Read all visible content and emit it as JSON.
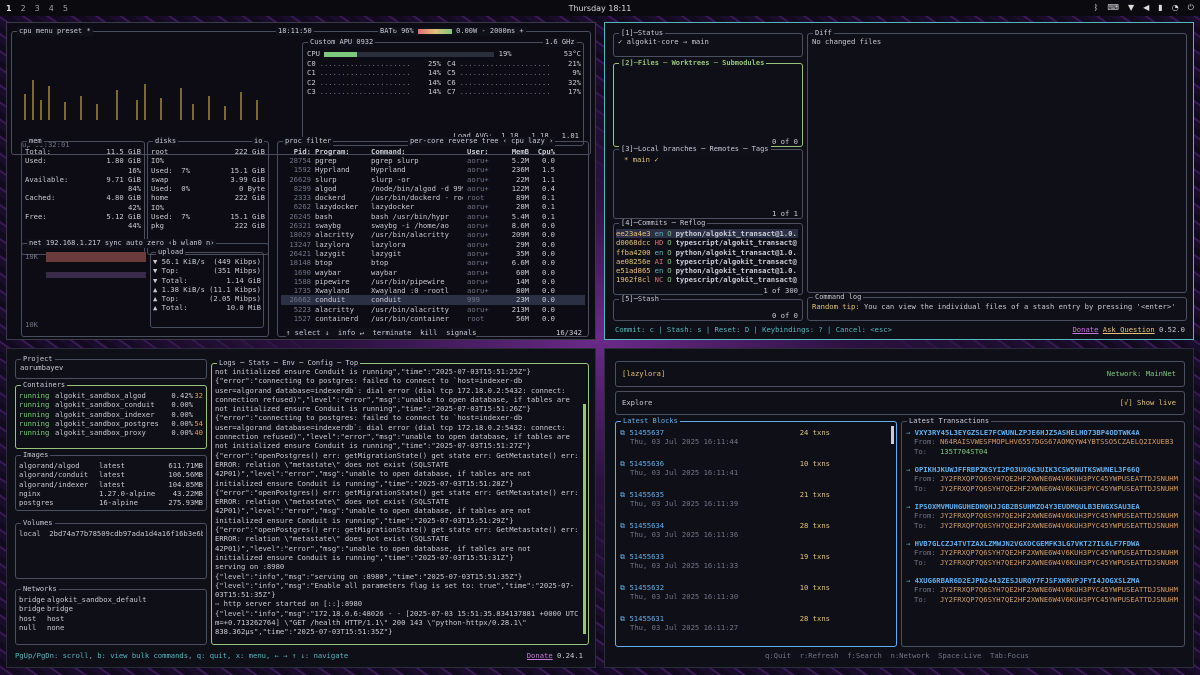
{
  "topbar": {
    "workspaces": [
      "1",
      "2",
      "3",
      "4",
      "5"
    ],
    "active": "1",
    "clock": "Thursday 18:11"
  },
  "btop": {
    "cpu_title": "cpu",
    "menu": "menu",
    "preset": "preset *",
    "time": "18:11:50",
    "bat": "BAT↻ 96%",
    "power": "0.00W",
    "interval": "- 2000ms +",
    "uptime": "up 00:32:01",
    "cpu_model": "Custom APU 0932",
    "freq": "1.6 GHz",
    "cpu_total": {
      "label": "CPU",
      "pct": "19%",
      "temp": "53°C",
      "fill": 0.19
    },
    "cores": [
      {
        "l": "C0",
        "p": "25%",
        "r": "C4",
        "rp": "21%"
      },
      {
        "l": "C1",
        "p": "14%",
        "r": "C5",
        "rp": "9%"
      },
      {
        "l": "C2",
        "p": "14%",
        "r": "C6",
        "rp": "32%"
      },
      {
        "l": "C3",
        "p": "14%",
        "r": "C7",
        "rp": "17%"
      }
    ],
    "load": "Load AVG:  1.18   1.18   1.01",
    "mem": {
      "title": "mem",
      "rows": [
        [
          "Total:",
          "11.5 GiB"
        ],
        [
          "Used:",
          "1.80 GiB"
        ],
        [
          "",
          "16%"
        ],
        [
          "Available:",
          "9.71 GiB"
        ],
        [
          "",
          "84%"
        ],
        [
          "Cached:",
          "4.80 GiB"
        ],
        [
          "",
          "42%"
        ],
        [
          "Free:",
          "5.12 GiB"
        ],
        [
          "",
          "44%"
        ]
      ]
    },
    "disks": {
      "title": "disks",
      "io": "io",
      "rows": [
        [
          "root",
          "222 GiB"
        ],
        [
          "IO%",
          ""
        ],
        [
          "Used:  7%",
          "15.1 GiB"
        ],
        [
          "swap",
          "3.99 GiB"
        ],
        [
          "Used:  0%",
          "0 Byte"
        ],
        [
          "home",
          "222 GiB"
        ],
        [
          "IO%",
          ""
        ],
        [
          "Used:  7%",
          "15.1 GiB"
        ],
        [
          "pkg",
          "222 GiB"
        ]
      ]
    },
    "net": {
      "title": "net",
      "ip": "192.168.1.217",
      "sync": "sync",
      "auto": "auto",
      "zero": "zero",
      "iface": "‹b wlan0 n›",
      "scale_top": "10K",
      "scale_bot": "10K",
      "upload": "upload",
      "rows": [
        [
          "▼ 56.1 KiB/s",
          "(449 Kibps)"
        ],
        [
          "▼ Top:",
          "(351 Mibps)"
        ],
        [
          "▼ Total:",
          "1.14 GiB"
        ],
        [
          "▲ 1.38 KiB/s",
          "(11.1 Kibps)"
        ],
        [
          "▲ Top:",
          "(2.05 Mibps)"
        ],
        [
          "▲ Total:",
          "10.0 MiB"
        ]
      ]
    },
    "proc": {
      "title": "proc",
      "filter": "filter",
      "opts": "per-core  reverse  tree  ‹ cpu lazy ›",
      "headers": [
        "Pid:",
        "Program:",
        "Command:",
        "User:",
        "MemB",
        "Cpu%"
      ],
      "rows": [
        [
          "28754",
          "pgrep",
          "pgrep slurp",
          "aoru+",
          "5.2M",
          "0.0"
        ],
        [
          "1592",
          "Hyprland",
          "Hyprland",
          "aoru+",
          "236M",
          "1.5"
        ],
        [
          "26629",
          "slurp",
          "slurp -or",
          "aoru+",
          "22M",
          "1.1"
        ],
        [
          "8299",
          "algod",
          "/node/bin/algod -d 999",
          "aoru+",
          "122M",
          "0.4"
        ],
        [
          "2333",
          "dockerd",
          "/usr/bin/dockerd - root",
          "root",
          "89M",
          "0.1"
        ],
        [
          "6262",
          "lazydocker",
          "lazydocker",
          "aoru+",
          "28M",
          "0.1"
        ],
        [
          "26245",
          "bash",
          "bash /usr/bin/hypr",
          "aoru+",
          "5.4M",
          "0.1"
        ],
        [
          "26321",
          "swaybg",
          "swaybg -i /home/ao",
          "aoru+",
          "8.6M",
          "0.0"
        ],
        [
          "18029",
          "alacritty",
          "/usr/bin/alacritty",
          "aoru+",
          "209M",
          "0.0"
        ],
        [
          "13247",
          "lazylora",
          "lazylora",
          "aoru+",
          "29M",
          "0.0"
        ],
        [
          "26421",
          "lazygit",
          "lazygit",
          "aoru+",
          "35M",
          "0.0"
        ],
        [
          "18148",
          "btop",
          "btop",
          "aoru+",
          "6.6M",
          "0.0"
        ],
        [
          "1690",
          "waybar",
          "waybar",
          "aoru+",
          "60M",
          "0.0"
        ],
        [
          "1588",
          "pipewire",
          "/usr/bin/pipewire",
          "aoru+",
          "14M",
          "0.0"
        ],
        [
          "1735",
          "Xwayland",
          "Xwayland :0 -rootl",
          "aoru+",
          "80M",
          "0.0"
        ],
        [
          "26662",
          "conduit",
          "conduit",
          "999",
          "23M",
          "0.0"
        ],
        [
          "5223",
          "alacritty",
          "/usr/bin/alacritty",
          "aoru+",
          "213M",
          "0.0"
        ],
        [
          "1527",
          "containerd",
          "/usr/bin/container",
          "root",
          "56M",
          "0.0"
        ]
      ],
      "selected": 15,
      "footer": "↑ select ↓  info ↵  terminate  kill  signals",
      "count": "16/342"
    }
  },
  "lazygit": {
    "status": {
      "title": "[1]─Status",
      "text": "✓ algokit-core → main"
    },
    "files": {
      "title": "[2]─Files ─ Worktrees ─ Submodules",
      "count": "0 of 0"
    },
    "branches": {
      "title": "[3]─Local branches ─ Remotes ─ Tags",
      "items": [
        "* main ✓"
      ],
      "count": "1 of 1"
    },
    "commits": {
      "title": "[4]─Commits ─ Reflog",
      "count": "1 of 300",
      "rows": [
        [
          "ee23a4e3",
          "en",
          "O",
          "python/algokit_transact@1.0."
        ],
        [
          "d0068dcc",
          "HD",
          "O",
          "typescript/algokit_transact@"
        ],
        [
          "ffba4200",
          "en",
          "O",
          "python/algokit_transact@1.0."
        ],
        [
          "ae08256e",
          "AI",
          "O",
          "typescript/algokit_transact@"
        ],
        [
          "e51ad865",
          "en",
          "O",
          "python/algokit_transact@1.0."
        ],
        [
          "1962f8cl",
          "NC",
          "O",
          "typescript/algokit_transact@"
        ]
      ]
    },
    "stash": {
      "title": "[5]─Stash",
      "count": "0 of 0"
    },
    "diff": {
      "title": "Diff",
      "text": "No changed files"
    },
    "cmdlog": {
      "title": "Command log",
      "tip_label": "Random tip:",
      "tip": "You can view the individual files of a stash entry by pressing '<enter>'"
    },
    "keys": "Commit: c | Stash: s | Reset: D | Keybindings: ? | Cancel: <esc>",
    "donate": "Donate",
    "ask": "Ask Question",
    "version": "0.52.0"
  },
  "ldock": {
    "project": {
      "title": "Project",
      "name": "aorumbayev"
    },
    "containers": {
      "title": "Containers",
      "rows": [
        [
          "running",
          "algokit_sandbox_algod",
          "0.42%",
          "32"
        ],
        [
          "running",
          "algokit_sandbox_conduit",
          "0.00%",
          ""
        ],
        [
          "running",
          "algokit_sandbox_indexer",
          "0.00%",
          ""
        ],
        [
          "running",
          "algokit_sandbox_postgres",
          "0.00%",
          "54"
        ],
        [
          "running",
          "algokit_sandbox_proxy",
          "0.00%",
          "40"
        ]
      ]
    },
    "images": {
      "title": "Images",
      "rows": [
        [
          "algorand/algod",
          "latest",
          "611.71MB"
        ],
        [
          "algorand/conduit",
          "latest",
          "106.56MB"
        ],
        [
          "algorand/indexer",
          "latest",
          "104.85MB"
        ],
        [
          "nginx",
          "1.27.0-alpine",
          "43.22MB"
        ],
        [
          "postgres",
          "16-alpine",
          "275.93MB"
        ]
      ]
    },
    "volumes": {
      "title": "Volumes",
      "rows": [
        "local  2bd74a77b78509cdb97ada1d4a16f16b3e6b"
      ]
    },
    "networks": {
      "title": "Networks",
      "rows": [
        [
          "bridge",
          "algokit_sandbox_default"
        ],
        [
          "bridge",
          "bridge"
        ],
        [
          "host",
          "host"
        ],
        [
          "null",
          "none"
        ]
      ]
    },
    "logs": {
      "title": "Logs ─ Stats ─ Env ─ Config ─ Top",
      "lines": [
        "not initialized ensure Conduit is running\",\"time\":\"2025-07-03T15:51:25Z\"}",
        "{\"error\":\"connecting to postgres: failed to connect to `host=indexer-db",
        "user=algorand database=indexerdb`: dial error (dial tcp 172.18.0.2:5432: connect:",
        "connection refused)\",\"level\":\"error\",\"msg\":\"unable to open database, if tables are",
        "not initialized ensure Conduit is running\",\"time\":\"2025-07-03T15:51:26Z\"}",
        "{\"error\":\"connecting to postgres: failed to connect to `host=indexer-db",
        "user=algorand database=indexerdb`: dial error (dial tcp 172.18.0.2:5432: connect:",
        "connection refused)\",\"level\":\"error\",\"msg\":\"unable to open database, if tables are",
        "not initialized ensure Conduit is running\",\"time\":\"2025-07-03T15:51:27Z\"}",
        "{\"error\":\"openPostgres() err: getMigrationState() get state err: GetMetastate() err:",
        "ERROR: relation \\\"metastate\\\" does not exist (SQLSTATE",
        "42P01)\",\"level\":\"error\",\"msg\":\"unable to open database, if tables are not",
        "initialized ensure Conduit is running\",\"time\":\"2025-07-03T15:51:28Z\"}",
        "{\"error\":\"openPostgres() err: getMigrationState() get state err: GetMetastate() err:",
        "ERROR: relation \\\"metastate\\\" does not exist (SQLSTATE",
        "42P01)\",\"level\":\"error\",\"msg\":\"unable to open database, if tables are not",
        "initialized ensure Conduit is running\",\"time\":\"2025-07-03T15:51:29Z\"}",
        "{\"error\":\"openPostgres() err: getMigrationState() get state err: GetMetastate() err:",
        "ERROR: relation \\\"metastate\\\" does not exist (SQLSTATE",
        "42P01)\",\"level\":\"error\",\"msg\":\"unable to open database, if tables are not",
        "initialized ensure Conduit is running\",\"time\":\"2025-07-03T15:51:31Z\"}",
        "serving on :8980",
        "{\"level\":\"info\",\"msg\":\"serving on :8980\",\"time\":\"2025-07-03T15:51:35Z\"}",
        "{\"level\":\"info\",\"msg\":\"Enable all parameters flag is set to: true\",\"time\":\"2025-07-",
        "03T15:51:35Z\"}",
        "⇨ http server started on [::]:8980",
        "{\"level\":\"info\",\"msg\":\"172.18.0.6:48026 - - [2025-07-03 15:51:35.834137881 +0000 UTC",
        "m=+0.713262764] \\\"GET /health HTTP/1.1\\\" 200 143 \\\"python-httpx/0.28.1\\\"",
        "838.362µs\",\"time\":\"2025-07-03T15:51:35Z\"}"
      ]
    },
    "footer": "PgUp/PgDn: scroll, b: view bulk commands, q: quit, x: menu, ← → ↑ ↓: navigate",
    "donate": "Donate",
    "version": "0.24.1"
  },
  "lora": {
    "app": "[lazylora]",
    "network": "Network: MainNet",
    "explore": "Explore",
    "show_live": "[√] Show live",
    "blocks_title": "Latest Blocks",
    "blocks": [
      [
        "51455637",
        "24 txns",
        "Thu, 03 Jul 2025 16:11:44"
      ],
      [
        "51455636",
        "10 txns",
        "Thu, 03 Jul 2025 16:11:41"
      ],
      [
        "51455635",
        "21 txns",
        "Thu, 03 Jul 2025 16:11:39"
      ],
      [
        "51455634",
        "28 txns",
        "Thu, 03 Jul 2025 16:11:36"
      ],
      [
        "51455633",
        "19 txns",
        "Thu, 03 Jul 2025 16:11:33"
      ],
      [
        "51455632",
        "10 txns",
        "Thu, 03 Jul 2025 16:11:30"
      ],
      [
        "51455631",
        "28 txns",
        "Thu, 03 Jul 2025 16:11:27"
      ]
    ],
    "tx_title": "Latest Transactions",
    "txs": [
      {
        "id": "VXY3RY45L3EYGZSLE7FCWUNLZPJE6HJZ5ASHELHO73BP4ODTWK4A",
        "from": "N64RAISVWESFMOPLHV6557DGS67AOMQYW4YBTSSO5CZAELQ2IXUEB3",
        "to": "135T704ST04"
      },
      {
        "id": "OPIKHJKUWJFFRBPZKSYI2PO3UXQG3UIK3CSW5NUTKSWUNEL3F66Q",
        "from": "JY2FRXQP7Q6SYH7QE2HF2XWNE6W4V6KUH3PYC45YWPUSEATTDJSNUHM",
        "to": "JY2FRXQP7Q6SYH7QE2HF2XWNE6W4V6KUH3PYC45YWPUSEATTDJSNUHM"
      },
      {
        "id": "IPSOXMVMUHGUHEDHQHJJGB2BSUHMZO4Y3EUDMQULB3ENGXSAU3EA",
        "from": "JY2FRXQP7Q6SYH7QE2HF2XWNE6W4V6KUH3PYC45YWPUSEATTDJSNUHM",
        "to": "JY2FRXQP7Q6SYH7QE2HF2XWNE6W4V6KUH3PYC45YWPUSEATTDJSNUHM"
      },
      {
        "id": "HVB7GLCZJ4TVTZAXLZMWJN2VGXOCGEMFK3LG7VKT27IL6LF7FDWA",
        "from": "JY2FRXQP7Q6SYH7QE2HF2XWNE6W4V6KUH3PYC45YWPUSEATTDJSNUHM",
        "to": "JY2FRXQP7Q6SYH7QE2HF2XWNE6W4V6KUH3PYC45YWPUSEATTDJSNUHM"
      },
      {
        "id": "4XUG6RBAR6D2EJPN2443ZESJURQY7FJSFXKRVPJFYI4JOGXSLZMA",
        "from": "JY2FRXQP7Q6SYH7QE2HF2XWNE6W4V6KUH3PYC45YWPUSEATTDJSNUHM",
        "to": "JY2FRXQP7Q6SYH7QE2HF2XWNE6W4V6KUH3PYC45YWPUSEATTDJSNUHM"
      }
    ],
    "footer": "q:Quit  r:Refresh  f:Search  n:Network  Space:Live  Tab:Focus"
  }
}
